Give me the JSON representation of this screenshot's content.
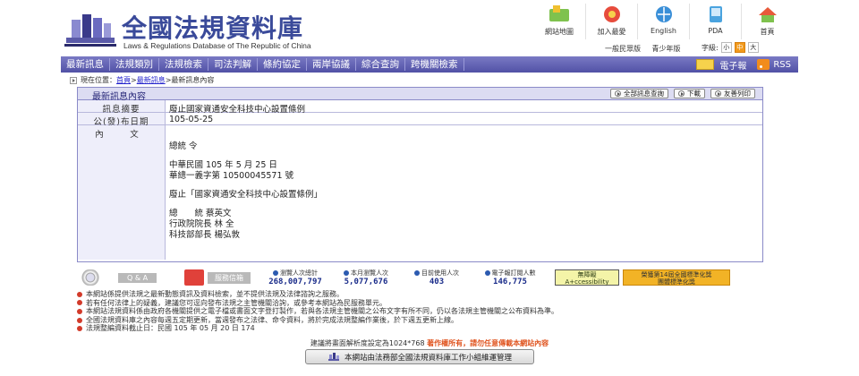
{
  "header": {
    "site_title": "全國法規資料庫",
    "site_subtitle": "Laws & Regulations Database of The Republic of China",
    "top_icons": [
      {
        "label": "網站地圖",
        "icon": "sitemap-icon"
      },
      {
        "label": "加入最愛",
        "icon": "favorite-icon"
      },
      {
        "label": "English",
        "icon": "english-icon"
      },
      {
        "label": "PDA",
        "icon": "pda-icon"
      },
      {
        "label": "首頁",
        "icon": "home-icon"
      }
    ],
    "version_links": [
      "一般民眾版",
      "青少年版"
    ],
    "font_size_label": "字級:",
    "font_sizes": [
      "小",
      "中",
      "大"
    ]
  },
  "nav": {
    "items": [
      "最新訊息",
      "法規類別",
      "法規檢索",
      "司法判解",
      "條約協定",
      "兩岸協議",
      "綜合查詢",
      "跨機關檢索"
    ],
    "ebook": "電子報",
    "rss": "RSS"
  },
  "breadcrumb": {
    "prefix": "現在位置：",
    "home": "首頁",
    "sep1": ">",
    "news": "最新訊息",
    "sep2": ">",
    "current": "最新訊息內容"
  },
  "panel": {
    "title": "最新訊息內容",
    "actions": [
      "全部訊息查詢",
      "下載",
      "友善列印"
    ],
    "rows": {
      "summary_label": "訊息摘要",
      "summary_value": "廢止國家資通安全科技中心設置條例",
      "date_label": "公(發)布日期",
      "date_value": "105-05-25",
      "content_label": "內　文"
    },
    "content_lines": [
      "總統  令",
      "",
      "中華民國 105 年 5 月 25 日",
      "華總一義字第 10500045571 號",
      "",
      "廢止「國家資通安全科技中心設置條例」",
      "",
      "總　　統  蔡英文",
      "行政院院長  林  全",
      "科技部部長  楊弘敦"
    ]
  },
  "stats": {
    "qa": "Q & A",
    "mail": "服務信箱",
    "items": [
      {
        "label": "瀏覽人次總計",
        "value": "268,007,797"
      },
      {
        "label": "本月瀏覽人次",
        "value": "5,077,676"
      },
      {
        "label": "目前使用人次",
        "value": "403"
      },
      {
        "label": "電子報訂閱人數",
        "value": "146,775"
      }
    ],
    "badge_access_line1": "無障礙",
    "badge_access_line2": "A+ccessibility",
    "badge_award_line1": "榮獲第14屆全國標準化獎",
    "badge_award_line2": "團體標準化獎"
  },
  "notes": [
    "本網站係提供法規之最新動態資訊及資料檢索，並不提供法規及法律諮詢之服務。",
    "若有任何法律上的疑義，建議您可逕向發布法規之主管機關洽詢，或參考本網站為民服務單元。",
    "本網站法規資料係由政府各機關提供之電子檔或書面文字登打製作，若與各法規主管機關之公布文字有所不同，仍以各法規主管機關之公布資料為準。",
    "全國法規資料庫之內容每週五定期更新，當週發布之法律、命令資料，將於完成法規整編作業後，於下週五更新上線。",
    "法規整編資料截止日：民國 105 年 05 月 20 日 174"
  ],
  "footer": {
    "resolution_note": "建議將畫面解析度設定為1024*768",
    "copyright_note": "著作權所有，請勿任意傳載本網站內容",
    "maintainer": "本網站由法務部全國法規資料庫工作小組維運管理"
  }
}
